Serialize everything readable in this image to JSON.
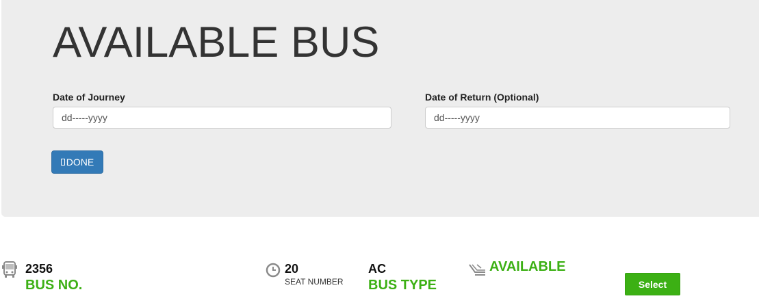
{
  "header": {
    "title": "AVAILABLE BUS"
  },
  "form": {
    "journey_label": "Date of Journey",
    "journey_placeholder": "dd-----yyyy",
    "return_label": "Date of Return (Optional)",
    "return_placeholder": "dd-----yyyy",
    "done_label": "DONE"
  },
  "bus": {
    "bus_number": "2356",
    "bus_number_label": "BUS NO.",
    "seat_number": "20",
    "seat_number_label": "SEAT NUMBER",
    "bus_type": "AC",
    "bus_type_label": "BUS TYPE",
    "availability": "AVAILABLE",
    "select_label": "Select"
  },
  "icons": {
    "bus": "bus-icon",
    "clock": "clock-icon",
    "seat": "seat-icon"
  },
  "colors": {
    "primary_blue": "#337ab7",
    "accent_green": "#3cb014",
    "hero_background": "#ededed"
  }
}
